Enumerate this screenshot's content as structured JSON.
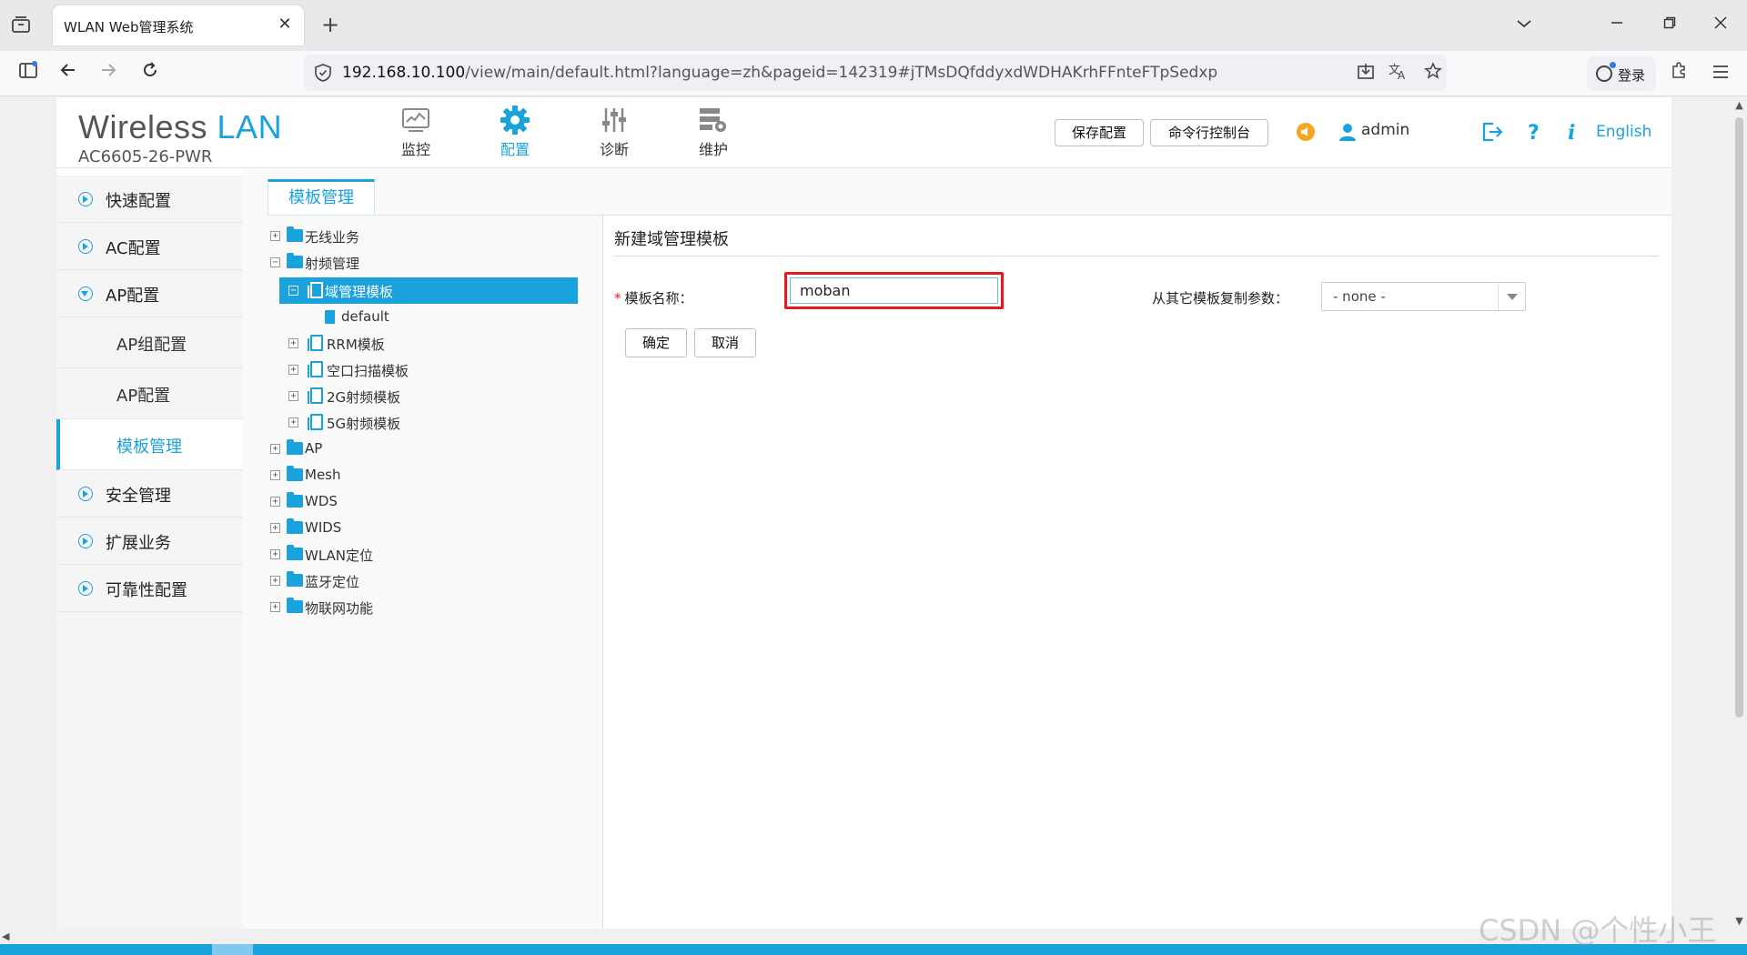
{
  "browser": {
    "tab_title": "WLAN Web管理系统",
    "tab_close": "✕",
    "new_tab": "+",
    "url_host": "192.168.10.100",
    "url_path": "/view/main/default.html?language=zh&pageid=142319#jTMsDQfddyxdWDHAKrhFFnteFTpSedxp",
    "login_label": "登录"
  },
  "app": {
    "logo_main": "Wireless",
    "logo_accent": "LAN",
    "model": "AC6605-26-PWR",
    "top_nav": [
      {
        "label": "监控",
        "icon": "monitor-icon"
      },
      {
        "label": "配置",
        "icon": "gear-icon"
      },
      {
        "label": "诊断",
        "icon": "sliders-icon"
      },
      {
        "label": "维护",
        "icon": "maintenance-icon"
      }
    ],
    "save_config": "保存配置",
    "cli_console": "命令行控制台",
    "username": "admin",
    "language_switch": "English"
  },
  "sidebar": {
    "items": [
      {
        "label": "快速配置"
      },
      {
        "label": "AC配置"
      },
      {
        "label": "AP配置"
      },
      {
        "label": "AP组配置"
      },
      {
        "label": "AP配置"
      },
      {
        "label": "模板管理"
      },
      {
        "label": "安全管理"
      },
      {
        "label": "扩展业务"
      },
      {
        "label": "可靠性配置"
      }
    ]
  },
  "content": {
    "tab_label": "模板管理",
    "tree": [
      {
        "label": "无线业务"
      },
      {
        "label": "射频管理"
      },
      {
        "label": "域管理模板"
      },
      {
        "label": "default"
      },
      {
        "label": "RRM模板"
      },
      {
        "label": "空口扫描模板"
      },
      {
        "label": "2G射频模板"
      },
      {
        "label": "5G射频模板"
      },
      {
        "label": "AP"
      },
      {
        "label": "Mesh"
      },
      {
        "label": "WDS"
      },
      {
        "label": "WIDS"
      },
      {
        "label": "WLAN定位"
      },
      {
        "label": "蓝牙定位"
      },
      {
        "label": "物联网功能"
      }
    ],
    "panel_title": "新建域管理模板",
    "name_label": "模板名称：",
    "name_value": "moban",
    "copy_label": "从其它模板复制参数：",
    "copy_value": "- none -",
    "ok_label": "确定",
    "cancel_label": "取消"
  },
  "watermark": "CSDN @个性小王",
  "colors": {
    "accent": "#1aa2dc",
    "highlight_border": "#e31b1b"
  }
}
